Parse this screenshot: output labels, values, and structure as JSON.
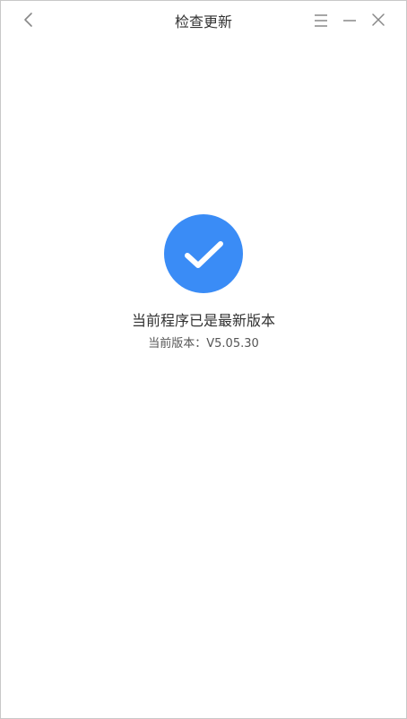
{
  "window": {
    "title": "检查更新"
  },
  "main": {
    "status_message": "当前程序已是最新版本",
    "version_label": "当前版本：",
    "version_value": "V5.05.30"
  },
  "icons": {
    "back": "back-arrow-icon",
    "menu": "menu-icon",
    "minimize": "minimize-icon",
    "close": "close-icon",
    "success": "checkmark-icon"
  },
  "colors": {
    "accent": "#3a8cf6",
    "text": "#333333",
    "icon": "#888888"
  }
}
